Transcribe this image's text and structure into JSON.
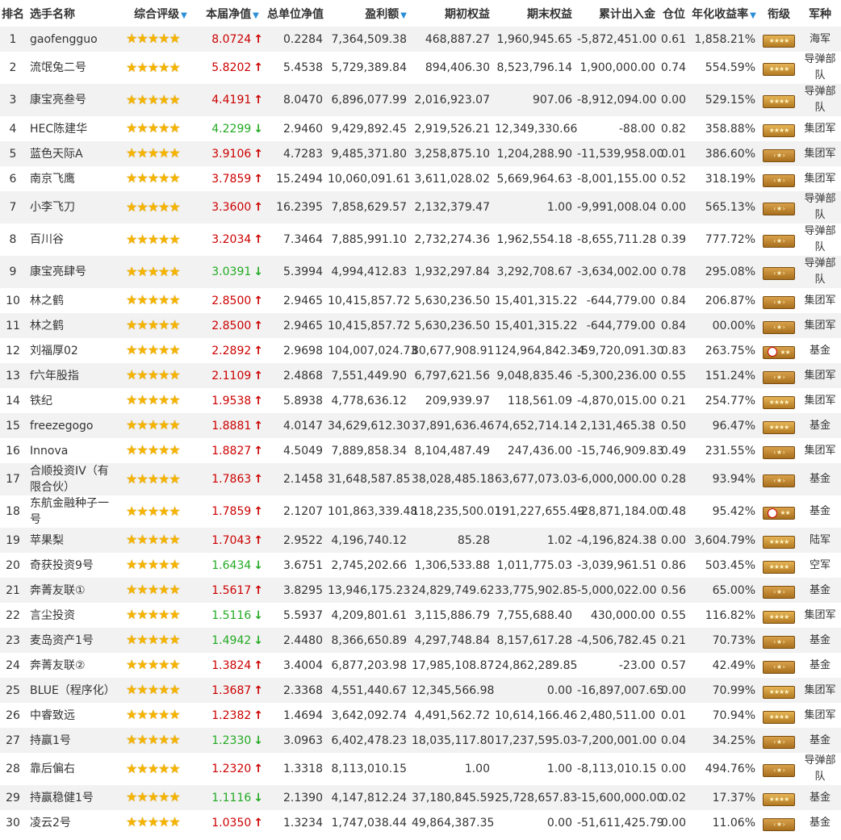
{
  "headers": {
    "rank": "排名",
    "name": "选手名称",
    "rating": "综合评级",
    "nav": "本届净值",
    "unit_nav": "总单位净值",
    "profit": "盈利额",
    "begin_equity": "期初权益",
    "end_equity": "期末权益",
    "net_flow": "累计出入金",
    "position": "仓位",
    "annual_return": "年化收益率",
    "title": "衔级",
    "army": "军种"
  },
  "sort_icon": "▼",
  "star_glyph": "★",
  "colors": {
    "up": "#cc0000",
    "down": "#22aa22",
    "sort": "#2a8fd6",
    "star": "#f5b400",
    "row_alt": "#f2f2f2"
  },
  "rows": [
    {
      "rank": "1",
      "name": "gaofengguo",
      "stars": 5,
      "nav": "8.0724",
      "dir": "up",
      "unit_nav": "0.2284",
      "profit": "7,364,509.38",
      "begin": "468,887.27",
      "end": "1,960,945.65",
      "flow": "-5,872,451.00",
      "pos": "0.61",
      "ann": "1,858.21%",
      "badge": "gold",
      "army": "海军"
    },
    {
      "rank": "2",
      "name": "流氓兔二号",
      "stars": 5,
      "nav": "5.8202",
      "dir": "up",
      "unit_nav": "5.4538",
      "profit": "5,729,389.84",
      "begin": "894,406.30",
      "end": "8,523,796.14",
      "flow": "1,900,000.00",
      "pos": "0.74",
      "ann": "554.59%",
      "badge": "gold",
      "army": "导弹部队"
    },
    {
      "rank": "3",
      "name": "康宝亮叁号",
      "stars": 5,
      "nav": "4.4191",
      "dir": "up",
      "unit_nav": "8.0470",
      "profit": "6,896,077.99",
      "begin": "2,016,923.07",
      "end": "907.06",
      "flow": "-8,912,094.00",
      "pos": "0.00",
      "ann": "529.15%",
      "badge": "gold",
      "army": "导弹部队"
    },
    {
      "rank": "4",
      "name": "HEC陈建华",
      "stars": 5,
      "nav": "4.2299",
      "dir": "down",
      "unit_nav": "2.9460",
      "profit": "9,429,892.45",
      "begin": "2,919,526.21",
      "end": "12,349,330.66",
      "flow": "-88.00",
      "pos": "0.82",
      "ann": "358.88%",
      "badge": "gold",
      "army": "集团军"
    },
    {
      "rank": "5",
      "name": "蓝色天际A",
      "stars": 5,
      "nav": "3.9106",
      "dir": "up",
      "unit_nav": "4.7283",
      "profit": "9,485,371.80",
      "begin": "3,258,875.10",
      "end": "1,204,288.90",
      "flow": "-11,539,958.00",
      "pos": "0.01",
      "ann": "386.60%",
      "badge": "plain",
      "army": "集团军"
    },
    {
      "rank": "6",
      "name": "南京飞鹰",
      "stars": 5,
      "nav": "3.7859",
      "dir": "up",
      "unit_nav": "15.2494",
      "profit": "10,060,091.61",
      "begin": "3,611,028.02",
      "end": "5,669,964.63",
      "flow": "-8,001,155.00",
      "pos": "0.52",
      "ann": "318.19%",
      "badge": "plain",
      "army": "集团军"
    },
    {
      "rank": "7",
      "name": "小李飞刀",
      "stars": 5,
      "nav": "3.3600",
      "dir": "up",
      "unit_nav": "16.2395",
      "profit": "7,858,629.57",
      "begin": "2,132,379.47",
      "end": "1.00",
      "flow": "-9,991,008.04",
      "pos": "0.00",
      "ann": "565.13%",
      "badge": "plain",
      "army": "导弹部队"
    },
    {
      "rank": "8",
      "name": "百川谷",
      "stars": 5,
      "nav": "3.2034",
      "dir": "up",
      "unit_nav": "7.3464",
      "profit": "7,885,991.10",
      "begin": "2,732,274.36",
      "end": "1,962,554.18",
      "flow": "-8,655,711.28",
      "pos": "0.39",
      "ann": "777.72%",
      "badge": "plain",
      "army": "导弹部队"
    },
    {
      "rank": "9",
      "name": "康宝亮肆号",
      "stars": 5,
      "nav": "3.0391",
      "dir": "down",
      "unit_nav": "5.3994",
      "profit": "4,994,412.83",
      "begin": "1,932,297.84",
      "end": "3,292,708.67",
      "flow": "-3,634,002.00",
      "pos": "0.78",
      "ann": "295.08%",
      "badge": "plain",
      "army": "导弹部队"
    },
    {
      "rank": "10",
      "name": "林之鹤",
      "stars": 5,
      "nav": "2.8500",
      "dir": "up",
      "unit_nav": "2.9465",
      "profit": "10,415,857.72",
      "begin": "5,630,236.50",
      "end": "15,401,315.22",
      "flow": "-644,779.00",
      "pos": "0.84",
      "ann": "206.87%",
      "badge": "plain",
      "army": "集团军"
    },
    {
      "rank": "11",
      "name": "林之鹤",
      "stars": 5,
      "nav": "2.8500",
      "dir": "up",
      "unit_nav": "2.9465",
      "profit": "10,415,857.72",
      "begin": "5,630,236.50",
      "end": "15,401,315.22",
      "flow": "-644,779.00",
      "pos": "0.84",
      "ann": "00.00%",
      "badge": "plain",
      "army": "集团军"
    },
    {
      "rank": "12",
      "name": "刘福厚02",
      "stars": 5,
      "nav": "2.2892",
      "dir": "up",
      "unit_nav": "2.9698",
      "profit": "104,007,024.73",
      "begin": "80,677,908.91",
      "end": "124,964,842.34",
      "flow": "-59,720,091.30",
      "pos": "0.83",
      "ann": "263.75%",
      "badge": "fund",
      "army": "基金"
    },
    {
      "rank": "13",
      "name": "f六年股指",
      "stars": 5,
      "nav": "2.1109",
      "dir": "up",
      "unit_nav": "2.4868",
      "profit": "7,551,449.90",
      "begin": "6,797,621.56",
      "end": "9,048,835.46",
      "flow": "-5,300,236.00",
      "pos": "0.55",
      "ann": "151.24%",
      "badge": "plain",
      "army": "集团军"
    },
    {
      "rank": "14",
      "name": "铁纪",
      "stars": 5,
      "nav": "1.9538",
      "dir": "up",
      "unit_nav": "5.8938",
      "profit": "4,778,636.12",
      "begin": "209,939.97",
      "end": "118,561.09",
      "flow": "-4,870,015.00",
      "pos": "0.21",
      "ann": "254.77%",
      "badge": "gold",
      "army": "集团军"
    },
    {
      "rank": "15",
      "name": "freezegogo",
      "stars": 5,
      "nav": "1.8881",
      "dir": "up",
      "unit_nav": "4.0147",
      "profit": "34,629,612.30",
      "begin": "37,891,636.46",
      "end": "74,652,714.14",
      "flow": "2,131,465.38",
      "pos": "0.50",
      "ann": "96.47%",
      "badge": "gold",
      "army": "基金"
    },
    {
      "rank": "16",
      "name": "Innova",
      "stars": 5,
      "nav": "1.8827",
      "dir": "up",
      "unit_nav": "4.5049",
      "profit": "7,889,858.34",
      "begin": "8,104,487.49",
      "end": "247,436.00",
      "flow": "-15,746,909.83",
      "pos": "0.49",
      "ann": "231.55%",
      "badge": "plain",
      "army": "集团军"
    },
    {
      "rank": "17",
      "name": "合顺投资IV（有限合伙）",
      "stars": 5,
      "nav": "1.7863",
      "dir": "up",
      "unit_nav": "2.1458",
      "profit": "31,648,587.85",
      "begin": "38,028,485.18",
      "end": "63,677,073.03",
      "flow": "-6,000,000.00",
      "pos": "0.28",
      "ann": "93.94%",
      "badge": "plain",
      "army": "基金"
    },
    {
      "rank": "18",
      "name": "东航金融种子一号",
      "stars": 5,
      "nav": "1.7859",
      "dir": "up",
      "unit_nav": "2.1207",
      "profit": "101,863,339.48",
      "begin": "118,235,500.01",
      "end": "191,227,655.49",
      "flow": "-28,871,184.00",
      "pos": "0.48",
      "ann": "95.42%",
      "badge": "fund",
      "army": "基金"
    },
    {
      "rank": "19",
      "name": "苹果梨",
      "stars": 5,
      "nav": "1.7043",
      "dir": "up",
      "unit_nav": "2.9522",
      "profit": "4,196,740.12",
      "begin": "85.28",
      "end": "1.02",
      "flow": "-4,196,824.38",
      "pos": "0.00",
      "ann": "3,604.79%",
      "badge": "gold",
      "army": "陆军"
    },
    {
      "rank": "20",
      "name": "奇获投资9号",
      "stars": 5,
      "nav": "1.6434",
      "dir": "down",
      "unit_nav": "3.6751",
      "profit": "2,745,202.66",
      "begin": "1,306,533.88",
      "end": "1,011,775.03",
      "flow": "-3,039,961.51",
      "pos": "0.86",
      "ann": "503.45%",
      "badge": "gold",
      "army": "空军"
    },
    {
      "rank": "21",
      "name": "奔菁友联①",
      "stars": 5,
      "nav": "1.5617",
      "dir": "up",
      "unit_nav": "3.8295",
      "profit": "13,946,175.23",
      "begin": "24,829,749.62",
      "end": "33,775,902.85",
      "flow": "-5,000,022.00",
      "pos": "0.56",
      "ann": "65.00%",
      "badge": "plain",
      "army": "基金"
    },
    {
      "rank": "22",
      "name": "言尘投资",
      "stars": 5,
      "nav": "1.5116",
      "dir": "down",
      "unit_nav": "5.5937",
      "profit": "4,209,801.61",
      "begin": "3,115,886.79",
      "end": "7,755,688.40",
      "flow": "430,000.00",
      "pos": "0.55",
      "ann": "116.82%",
      "badge": "gold",
      "army": "集团军"
    },
    {
      "rank": "23",
      "name": "麦岛资产1号",
      "stars": 5,
      "nav": "1.4942",
      "dir": "down",
      "unit_nav": "2.4480",
      "profit": "8,366,650.89",
      "begin": "4,297,748.84",
      "end": "8,157,617.28",
      "flow": "-4,506,782.45",
      "pos": "0.21",
      "ann": "70.73%",
      "badge": "plain",
      "army": "基金"
    },
    {
      "rank": "24",
      "name": "奔菁友联②",
      "stars": 5,
      "nav": "1.3824",
      "dir": "up",
      "unit_nav": "3.4004",
      "profit": "6,877,203.98",
      "begin": "17,985,108.87",
      "end": "24,862,289.85",
      "flow": "-23.00",
      "pos": "0.57",
      "ann": "42.49%",
      "badge": "plain",
      "army": "基金"
    },
    {
      "rank": "25",
      "name": "BLUE（程序化）",
      "stars": 5,
      "nav": "1.3687",
      "dir": "up",
      "unit_nav": "2.3368",
      "profit": "4,551,440.67",
      "begin": "12,345,566.98",
      "end": "0.00",
      "flow": "-16,897,007.65",
      "pos": "0.00",
      "ann": "70.99%",
      "badge": "gold",
      "army": "集团军"
    },
    {
      "rank": "26",
      "name": "中睿致远",
      "stars": 5,
      "nav": "1.2382",
      "dir": "up",
      "unit_nav": "1.4694",
      "profit": "3,642,092.74",
      "begin": "4,491,562.72",
      "end": "10,614,166.46",
      "flow": "2,480,511.00",
      "pos": "0.01",
      "ann": "70.94%",
      "badge": "gold",
      "army": "集团军"
    },
    {
      "rank": "27",
      "name": "持赢1号",
      "stars": 5,
      "nav": "1.2330",
      "dir": "down",
      "unit_nav": "3.0963",
      "profit": "6,402,478.23",
      "begin": "18,035,117.80",
      "end": "17,237,595.03",
      "flow": "-7,200,001.00",
      "pos": "0.04",
      "ann": "34.25%",
      "badge": "plain",
      "army": "基金"
    },
    {
      "rank": "28",
      "name": "靠后偏右",
      "stars": 5,
      "nav": "1.2320",
      "dir": "up",
      "unit_nav": "1.3318",
      "profit": "8,113,010.15",
      "begin": "1.00",
      "end": "1.00",
      "flow": "-8,113,010.15",
      "pos": "0.00",
      "ann": "494.76%",
      "badge": "plain",
      "army": "导弹部队"
    },
    {
      "rank": "29",
      "name": "持赢稳健1号",
      "stars": 5,
      "nav": "1.1116",
      "dir": "down",
      "unit_nav": "2.1390",
      "profit": "4,147,812.24",
      "begin": "37,180,845.59",
      "end": "25,728,657.83",
      "flow": "-15,600,000.00",
      "pos": "0.02",
      "ann": "17.37%",
      "badge": "gold",
      "army": "基金"
    },
    {
      "rank": "30",
      "name": "凌云2号",
      "stars": 5,
      "nav": "1.0350",
      "dir": "up",
      "unit_nav": "1.3234",
      "profit": "1,747,038.44",
      "begin": "49,864,387.35",
      "end": "0.00",
      "flow": "-51,611,425.79",
      "pos": "0.00",
      "ann": "11.06%",
      "badge": "plain",
      "army": "基金"
    }
  ]
}
